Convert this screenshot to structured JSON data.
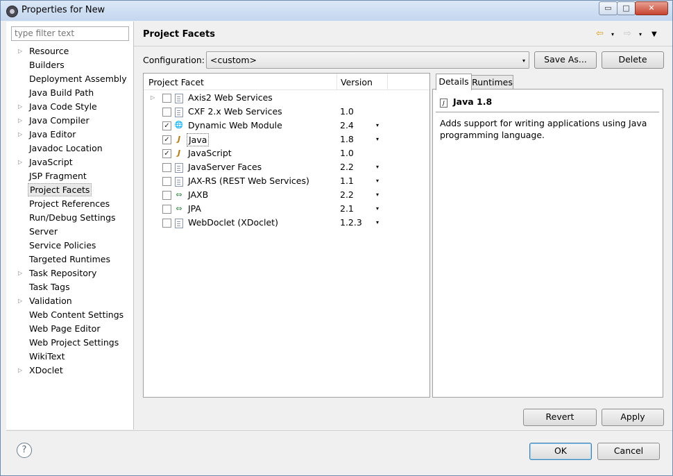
{
  "window": {
    "title": "Properties for New"
  },
  "left": {
    "filter_placeholder": "type filter text",
    "items": [
      {
        "label": "Resource",
        "expandable": true
      },
      {
        "label": "Builders",
        "expandable": false
      },
      {
        "label": "Deployment Assembly",
        "expandable": false
      },
      {
        "label": "Java Build Path",
        "expandable": false
      },
      {
        "label": "Java Code Style",
        "expandable": true
      },
      {
        "label": "Java Compiler",
        "expandable": true
      },
      {
        "label": "Java Editor",
        "expandable": true
      },
      {
        "label": "Javadoc Location",
        "expandable": false
      },
      {
        "label": "JavaScript",
        "expandable": true
      },
      {
        "label": "JSP Fragment",
        "expandable": false
      },
      {
        "label": "Project Facets",
        "expandable": false,
        "selected": true
      },
      {
        "label": "Project References",
        "expandable": false
      },
      {
        "label": "Run/Debug Settings",
        "expandable": false
      },
      {
        "label": "Server",
        "expandable": false
      },
      {
        "label": "Service Policies",
        "expandable": false
      },
      {
        "label": "Targeted Runtimes",
        "expandable": false
      },
      {
        "label": "Task Repository",
        "expandable": true
      },
      {
        "label": "Task Tags",
        "expandable": false
      },
      {
        "label": "Validation",
        "expandable": true
      },
      {
        "label": "Web Content Settings",
        "expandable": false
      },
      {
        "label": "Web Page Editor",
        "expandable": false
      },
      {
        "label": "Web Project Settings",
        "expandable": false
      },
      {
        "label": "WikiText",
        "expandable": false
      },
      {
        "label": "XDoclet",
        "expandable": true
      }
    ]
  },
  "page": {
    "title": "Project Facets",
    "config_label": "Configuration:",
    "config_value": "<custom>",
    "save_as": "Save As...",
    "delete": "Delete"
  },
  "facets": {
    "col_facet": "Project Facet",
    "col_version": "Version",
    "rows": [
      {
        "name": "Axis2 Web Services",
        "version": "",
        "checked": false,
        "expandable": true,
        "icon": "doc-icon",
        "dropdown": false
      },
      {
        "name": "CXF 2.x Web Services",
        "version": "1.0",
        "checked": false,
        "expandable": false,
        "icon": "doc-icon",
        "dropdown": false
      },
      {
        "name": "Dynamic Web Module",
        "version": "2.4",
        "checked": true,
        "expandable": false,
        "icon": "web-module-icon",
        "dropdown": true
      },
      {
        "name": "Java",
        "version": "1.8",
        "checked": true,
        "expandable": false,
        "icon": "java-icon",
        "dropdown": true,
        "selected": true
      },
      {
        "name": "JavaScript",
        "version": "1.0",
        "checked": true,
        "expandable": false,
        "icon": "javascript-icon",
        "dropdown": false
      },
      {
        "name": "JavaServer Faces",
        "version": "2.2",
        "checked": false,
        "expandable": false,
        "icon": "doc-icon",
        "dropdown": true
      },
      {
        "name": "JAX-RS (REST Web Services)",
        "version": "1.1",
        "checked": false,
        "expandable": false,
        "icon": "doc-icon",
        "dropdown": true
      },
      {
        "name": "JAXB",
        "version": "2.2",
        "checked": false,
        "expandable": false,
        "icon": "jaxb-icon",
        "dropdown": true
      },
      {
        "name": "JPA",
        "version": "2.1",
        "checked": false,
        "expandable": false,
        "icon": "jpa-icon",
        "dropdown": true
      },
      {
        "name": "WebDoclet (XDoclet)",
        "version": "1.2.3",
        "checked": false,
        "expandable": false,
        "icon": "doc-icon",
        "dropdown": true
      }
    ]
  },
  "details": {
    "tab_details": "Details",
    "tab_runtimes": "Runtimes",
    "title": "Java 1.8",
    "description": "Adds support for writing applications using Java programming language."
  },
  "buttons": {
    "revert": "Revert",
    "apply": "Apply",
    "ok": "OK",
    "cancel": "Cancel"
  },
  "window_buttons": {
    "minimize": "▭",
    "maximize": "□",
    "close": "✕"
  },
  "glyphs": {
    "expand": "▷",
    "dropdown": "▾",
    "check": "✓",
    "back": "⇦",
    "forward": "⇨",
    "menu": "▼",
    "help": "?"
  }
}
